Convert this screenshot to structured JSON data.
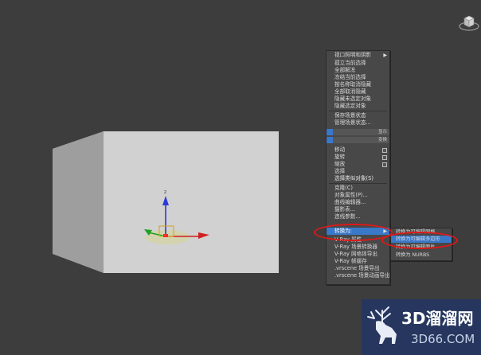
{
  "viewport": {
    "background": "#3d3d3d",
    "gizmo_axis_label": "z"
  },
  "quad_menu": {
    "items": [
      {
        "label": "视口照明和阴影",
        "arrow": "▶"
      },
      {
        "label": "孤立当前选择"
      },
      {
        "label": "全部解冻"
      },
      {
        "label": "冻结当前选择"
      },
      {
        "label": "按名称取消隐藏"
      },
      {
        "label": "全部取消隐藏"
      },
      {
        "label": "隐藏未选定对象"
      },
      {
        "label": "隐藏选定对象"
      },
      {
        "label": "保存场景状态"
      },
      {
        "label": "管理场景状态..."
      }
    ],
    "strip_glyphs": [
      "显示",
      "变换"
    ],
    "transform_items": [
      {
        "label": "移动"
      },
      {
        "label": "旋转"
      },
      {
        "label": "缩放"
      },
      {
        "label": "选择"
      },
      {
        "label": "选择类似对象(S)"
      }
    ],
    "more_items": [
      {
        "label": "克隆(C)"
      },
      {
        "label": "对象属性(P)..."
      },
      {
        "label": "曲线编辑器..."
      },
      {
        "label": "摄影表..."
      },
      {
        "label": "连线参数..."
      }
    ],
    "convert_item": {
      "label": "转换为:",
      "arrow": "▶"
    },
    "vray_items": [
      {
        "label": "V-Ray 属性"
      },
      {
        "label": "V-Ray 场景转换器"
      },
      {
        "label": "V-Ray 网格体导出"
      },
      {
        "label": "V-Ray 帧缓存"
      },
      {
        "label": ".vrscene 场景导出"
      },
      {
        "label": ".vrscene 场景动画导出"
      }
    ]
  },
  "convert_submenu": {
    "items": [
      {
        "label": "转换为可编辑网格"
      },
      {
        "label": "转换为可编辑多边形"
      },
      {
        "label": "转换为可编辑面片"
      },
      {
        "label": "转换为 NURBS"
      }
    ],
    "selected_index": 1
  },
  "watermark": {
    "title": "3D溜溜网",
    "url": "3D66.COM"
  },
  "colors": {
    "menu_bg": "#484848",
    "menu_text": "#d8d8d8",
    "highlight": "#3a78c8",
    "annotation_ring": "#e01818",
    "watermark_bg": "#26365e"
  }
}
